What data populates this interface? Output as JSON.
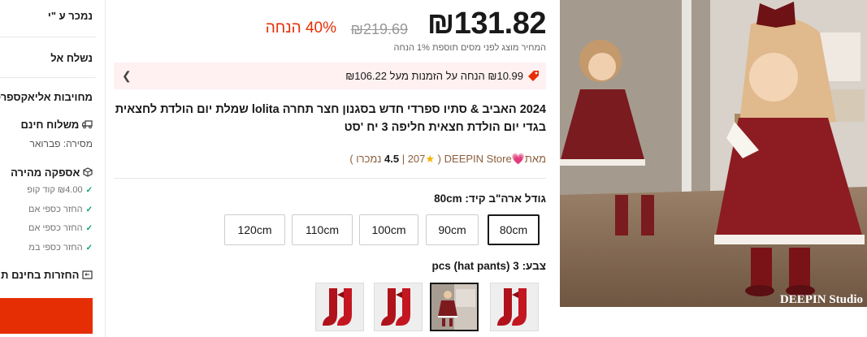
{
  "sidebar": {
    "sold_by": "נמכר ע \"י",
    "ships_from": "נשלח אל",
    "commitment": "מחויבות אליאקספרס",
    "free_shipping": "משלוח חינם",
    "delivery": "מסירה: פברואר",
    "fast_delivery": "אספקה מהירה",
    "refund_1": "₪4.00 קוד קופ",
    "refund_2": "החזר כספי אם",
    "refund_3": "החזר כספי אם",
    "refund_4": "החזר כספי במ",
    "free_returns": "החזרות בחינם ת"
  },
  "price": {
    "current": "₪131.82",
    "original": "₪219.69",
    "discount": "40% הנחה",
    "tax_note": "המחיר מוצג לפני מסים תוספת 1% הנחה"
  },
  "coupon": {
    "text": "₪10.99 הנחה על הזמנות מעל ₪106.22"
  },
  "product": {
    "title": "2024 האביב & סתיו ספרדי חדש בסגנון חצר תחרה lolita שמלת יום הולדת לחצאית בגדי יום הולדת חצאית חליפה 3 יח 'סט"
  },
  "store": {
    "prefix": "מאת",
    "name": "DEEPIN Store",
    "rating": "4.5",
    "sold": "207 נמכרו"
  },
  "size": {
    "label": "גודל ארה\"ב קיד: 80cm",
    "options": [
      "80cm",
      "90cm",
      "100cm",
      "110cm",
      "120cm"
    ],
    "selected": "80cm"
  },
  "color": {
    "label": "צבע: 3 pcs (hat pants)",
    "options": [
      "red-socks",
      "dress-set-3pcs",
      "red-socks",
      "red-socks"
    ],
    "selected_index": 1
  },
  "image": {
    "watermark": "DEEPIN Studio"
  },
  "colors": {
    "accent": "#e62e04",
    "coupon_bg": "#fff0f1",
    "store": "#8b5e3c"
  }
}
